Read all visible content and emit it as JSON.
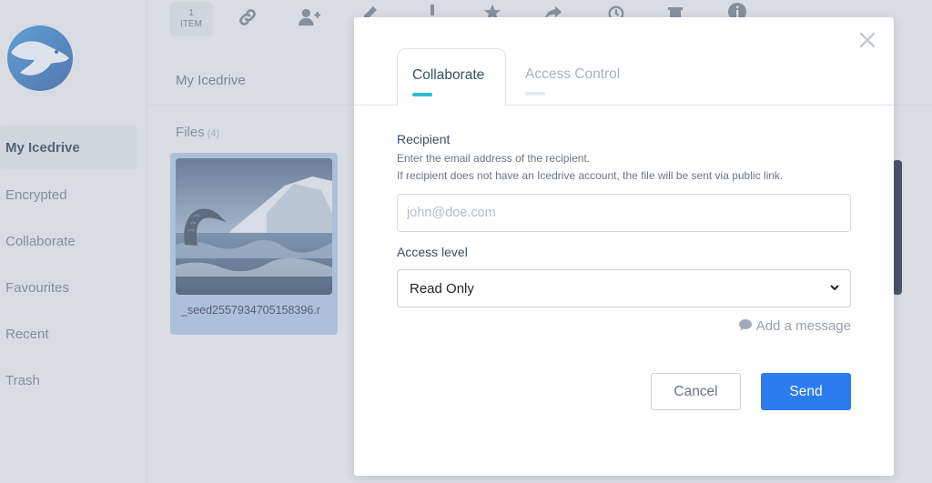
{
  "sidebar": {
    "items": [
      {
        "label": "My Icedrive",
        "active": true
      },
      {
        "label": "Encrypted"
      },
      {
        "label": "Collaborate"
      },
      {
        "label": "Favourites"
      },
      {
        "label": "Recent"
      },
      {
        "label": "Trash"
      }
    ]
  },
  "toolbar": {
    "item_count": "1",
    "item_unit": "ITEM",
    "icons": [
      "link-icon",
      "add-user-icon",
      "edit-icon",
      "download-icon",
      "star-icon",
      "share-icon",
      "history-icon",
      "trash-icon",
      "info-icon"
    ]
  },
  "main": {
    "breadcrumb": "My Icedrive",
    "files_label": "Files",
    "files_count": "(4)",
    "file_name": "_seed2557934705158396.r"
  },
  "modal": {
    "tabs": [
      {
        "label": "Collaborate",
        "active": true
      },
      {
        "label": "Access Control"
      }
    ],
    "recipient_label": "Recipient",
    "recipient_help_1": "Enter the email address of the recipient.",
    "recipient_help_2": "If recipient does not have an Icedrive account, the file will be sent via public link.",
    "recipient_placeholder": "john@doe.com",
    "access_label": "Access level",
    "access_value": "Read Only",
    "add_message": "Add a message",
    "cancel_label": "Cancel",
    "send_label": "Send"
  },
  "colors": {
    "accent": "#27c0d8",
    "primary_button": "#2c7cf0",
    "brand_dark": "#1c2f4a"
  }
}
